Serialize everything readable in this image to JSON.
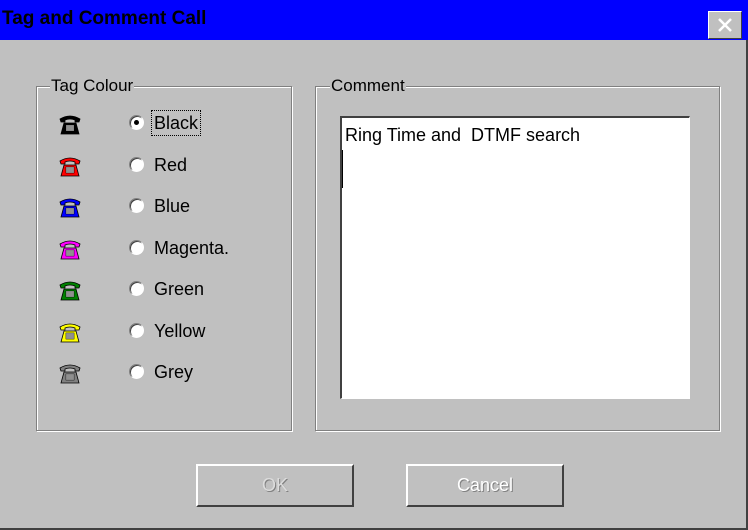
{
  "window": {
    "title": "Tag and Comment Call",
    "close_glyph": "✕",
    "titlebar_color": "#0000ff"
  },
  "tag_colour": {
    "legend": "Tag Colour",
    "selected": "Black",
    "options": [
      {
        "label": "Black",
        "color": "#000000",
        "checked": true
      },
      {
        "label": "Red",
        "color": "#ff0000",
        "checked": false
      },
      {
        "label": "Blue",
        "color": "#0000ff",
        "checked": false
      },
      {
        "label": "Magenta.",
        "color": "#ff00ff",
        "checked": false
      },
      {
        "label": "Green",
        "color": "#008000",
        "checked": false
      },
      {
        "label": "Yellow",
        "color": "#ffff00",
        "checked": false
      },
      {
        "label": "Grey",
        "color": "#808080",
        "checked": false
      }
    ]
  },
  "comment": {
    "legend": "Comment",
    "value": "Ring Time and  DTMF search"
  },
  "buttons": {
    "ok_label": "OK",
    "cancel_label": "Cancel"
  }
}
